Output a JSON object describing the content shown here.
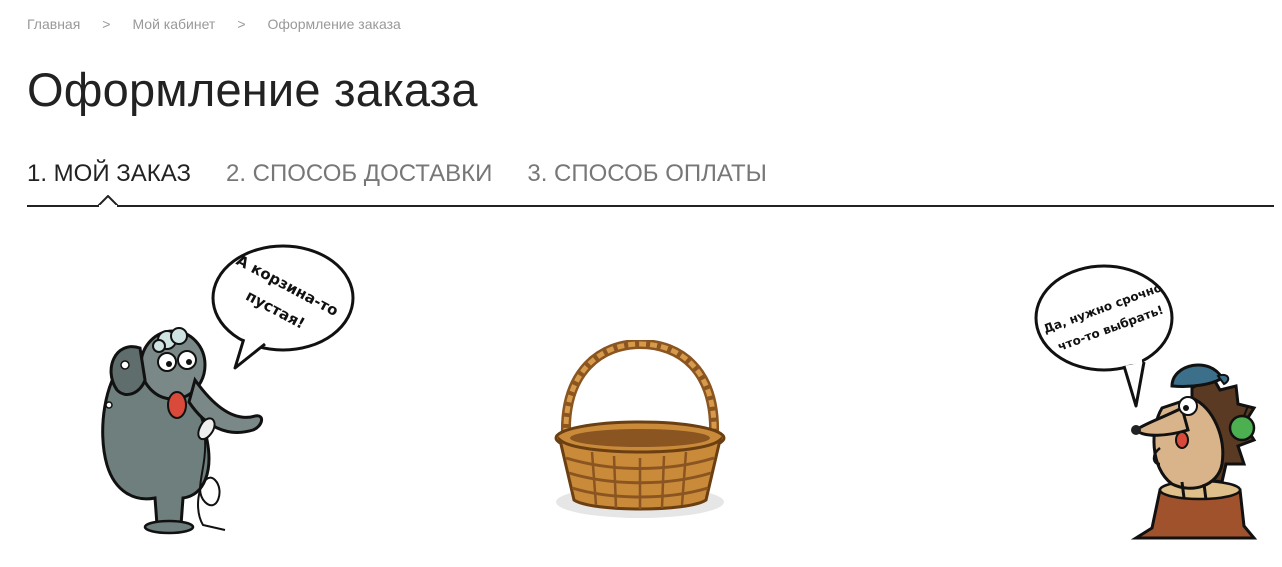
{
  "breadcrumb": {
    "items": [
      "Главная",
      "Мой кабинет",
      "Оформление заказа"
    ],
    "separator": ">"
  },
  "page": {
    "title": "Оформление заказа"
  },
  "steps": [
    {
      "label": "1. МОЙ ЗАКАЗ",
      "active": true
    },
    {
      "label": "2. СПОСОБ ДОСТАВКИ",
      "active": false
    },
    {
      "label": "3. СПОСОБ ОПЛАТЫ",
      "active": false
    }
  ],
  "empty_cart": {
    "left_bubble": {
      "line1": "А корзина-то",
      "line2": "пустая!"
    },
    "right_bubble": {
      "line1": "Да, нужно срочно",
      "line2": "что-то выбрать!"
    }
  },
  "colors": {
    "text_dark": "#222222",
    "text_muted": "#999999",
    "step_inactive": "#777777",
    "elephant": "#6f7f7d",
    "basket": "#c98a3a",
    "cap": "#3b6f8a"
  }
}
